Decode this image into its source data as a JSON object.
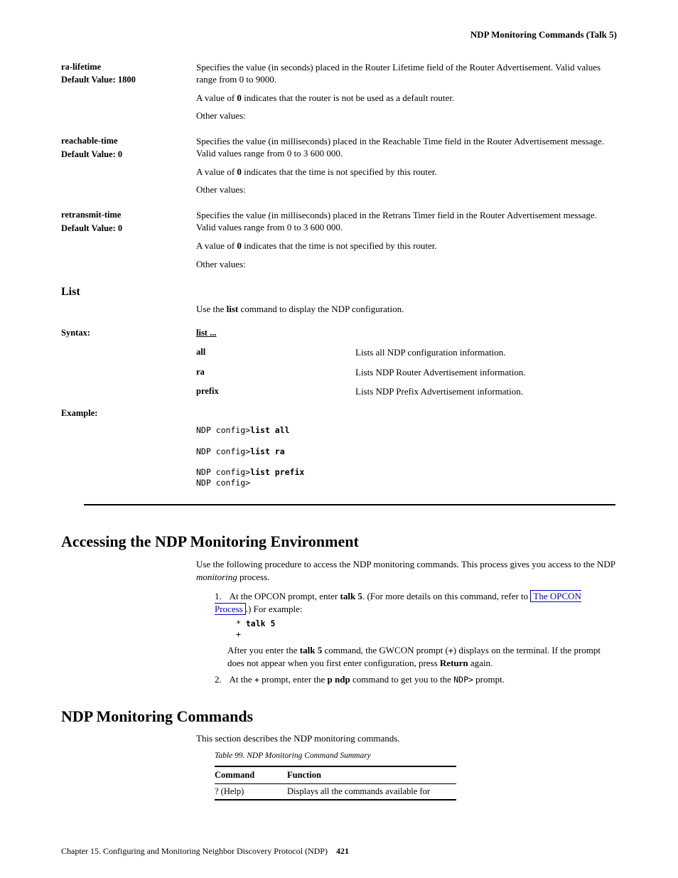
{
  "header": {
    "title": "NDP Monitoring Commands (Talk 5)"
  },
  "defs": [
    {
      "term": "ra-lifetime",
      "term_default": "Default Value: 1800",
      "para1": "Specifies the value (in seconds) placed in the Router Lifetime field of the Router Advertisement. Valid values range from 0 to 9000.",
      "para2_prefix": "A value of ",
      "para2_bold": "0",
      "para2_suffix": " indicates that the router is not be used as a default router.",
      "para3": "Other values:"
    },
    {
      "term": "reachable-time",
      "term_default": "Default Value: 0",
      "para1": "Specifies the value (in milliseconds) placed in the Reachable Time field in the Router Advertisement message. Valid values range from 0 to 3 600 000.",
      "para2_prefix": "A value of ",
      "para2_bold": "0",
      "para2_suffix": " indicates that the time is not specified by this router.",
      "para3": "Other values:"
    },
    {
      "term": "retransmit-time",
      "term_default": "Default Value: 0",
      "para1": "Specifies the value (in milliseconds) placed in the Retrans Timer field in the Router Advertisement message. Valid values range from 0 to 3 600 000.",
      "para2_prefix": "A value of ",
      "para2_bold": "0",
      "para2_suffix": " indicates that the time is not specified by this router.",
      "para3": "Other values:"
    }
  ],
  "list_section": {
    "heading": "List",
    "intro_prefix": "Use the ",
    "intro_bold": "list",
    "intro_suffix": " command to display the NDP configuration.",
    "syntax_label": "Syntax:",
    "syntax_cmd": "list ...",
    "options": [
      {
        "label": "all",
        "desc": "Lists all NDP configuration information."
      },
      {
        "label": "ra",
        "desc": "Lists NDP Router Advertisement information."
      },
      {
        "label": "prefix",
        "desc": "Lists NDP Prefix Advertisement information."
      }
    ],
    "example_label": "Example:",
    "example_lines": [
      {
        "type": "cmd",
        "prompt": "NDP config>",
        "cmd": "list all"
      },
      {
        "type": "blank"
      },
      {
        "type": "cmd",
        "prompt": "NDP config>",
        "cmd": "list ra"
      },
      {
        "type": "blank"
      },
      {
        "type": "cmd",
        "prompt": "NDP config>",
        "cmd": "list prefix"
      },
      {
        "type": "plain",
        "text": "NDP config>"
      }
    ]
  },
  "monitor": {
    "heading": "Accessing the NDP Monitoring Environment",
    "intro_prefix": "Use the following procedure to access the NDP monitoring commands. This process gives you access to the NDP ",
    "intro_italic": "monitoring",
    "intro_suffix": " process.",
    "step1_num": "1.",
    "step1_prefix": " At the OPCON prompt, enter ",
    "step1_bold": "talk 5",
    "step1_suffix": ". (For more details on this command, refer to ",
    "step1_link": "The OPCON Process",
    "step1_after": ".) For example:",
    "step1_ex1": "* talk 5",
    "step1_ex2": "+",
    "step1_post_prefix": "After you enter the ",
    "step1_post_bold": "talk 5",
    "step1_post_mid": " command, the GWCON prompt (",
    "step1_post_plus": "+",
    "step1_post_end": ") displays on the terminal. If the prompt does not appear when you first enter configuration, press ",
    "step1_post_ret": "Return",
    "step1_post_fin": " again.",
    "step2_num": "2.",
    "step2_prefix": " At the ",
    "step2_plus": "+",
    "step2_mid1": " prompt, enter the ",
    "step2_bold1": "p ndp",
    "step2_mid2": " command to get you to the ",
    "step2_prompt": "NDP>",
    "step2_end": " prompt."
  },
  "cmd_section": {
    "heading": "NDP Monitoring Commands",
    "intro": "This section describes the NDP monitoring commands.",
    "table_title": "Table 99. NDP Monitoring Command Summary",
    "head_cmd": "Command",
    "head_fn": "Function",
    "rows": [
      {
        "cmd": "? (Help)",
        "fn": "Displays all the commands available for"
      }
    ]
  },
  "footer": {
    "text": "Chapter 15. Configuring and Monitoring Neighbor Discovery Protocol (NDP)",
    "page": "421"
  }
}
